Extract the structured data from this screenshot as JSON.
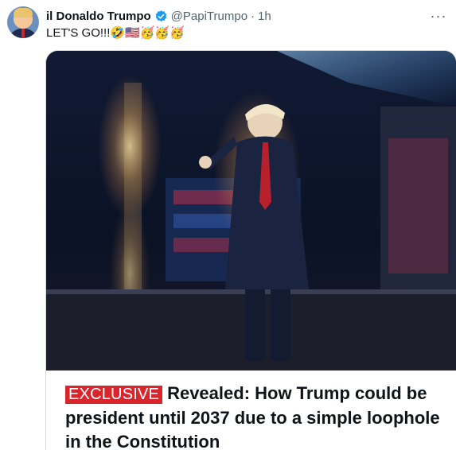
{
  "post": {
    "author_name": "il Donaldo Trumpo",
    "handle": "@PapiTrumpo",
    "separator": "·",
    "time": "1h",
    "text": "LET'S GO!!!🤣🇺🇸🥳🥳🥳"
  },
  "menu": {
    "more_label": "···"
  },
  "media": {
    "headline_tag": "EXCLUSIVE",
    "headline_text": "Revealed: How Trump could be president until 2037 due to a simple loophole in the Constitution"
  },
  "icons": {
    "avatar": "profile-photo",
    "verified": "verified-badge-icon",
    "more": "more-options-icon"
  },
  "colors": {
    "accent": "#1d9bf0",
    "tag": "#d8262c",
    "muted": "#536471"
  }
}
